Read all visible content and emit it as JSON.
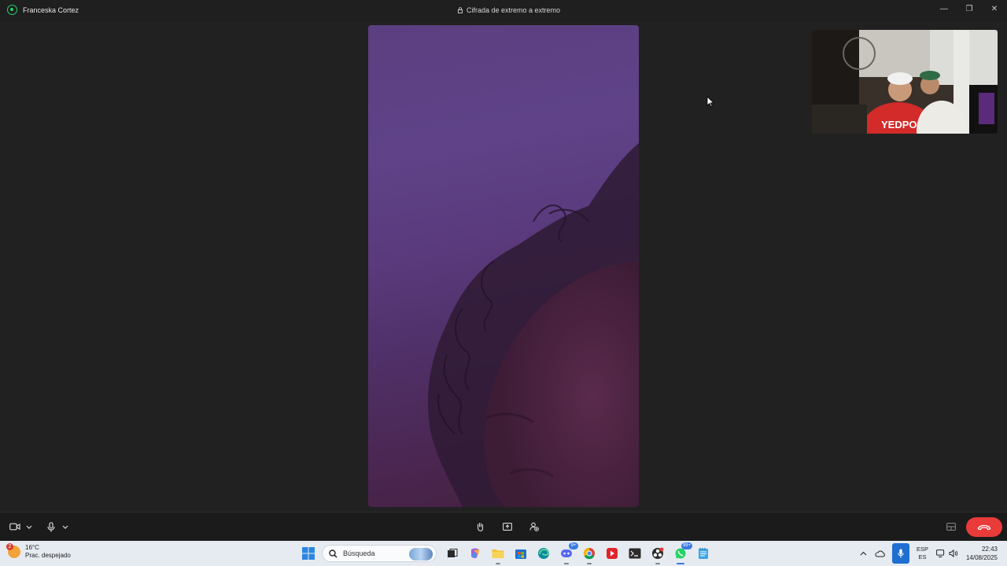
{
  "window": {
    "app_name": "WhatsApp",
    "contact_name": "Franceska Cortez",
    "encryption_label": "Cifrada de extremo a extremo",
    "controls": {
      "minimize": "—",
      "restore": "❐",
      "close": "✕"
    }
  },
  "call": {
    "remote_video_icon": "remote-participant-video",
    "self_video_text": "YEDPO"
  },
  "toolbar": {
    "camera_icon": "video-camera-icon",
    "mic_icon": "microphone-icon",
    "raise_hand_icon": "raise-hand-icon",
    "share_screen_icon": "share-screen-icon",
    "add_person_icon": "add-participant-icon",
    "layout_icon": "layout-icon",
    "end_call_color": "#ea3b3b"
  },
  "taskbar": {
    "weather": {
      "badge": "2",
      "temperature": "16°C",
      "condition": "Prac. despejado"
    },
    "search_placeholder": "Búsqueda",
    "app_badges": {
      "discord": "9+",
      "whatsapp": "99+"
    },
    "language": {
      "line1": "ESP",
      "line2": "ES"
    },
    "clock": {
      "time": "22:43",
      "date": "14/08/2025"
    }
  }
}
